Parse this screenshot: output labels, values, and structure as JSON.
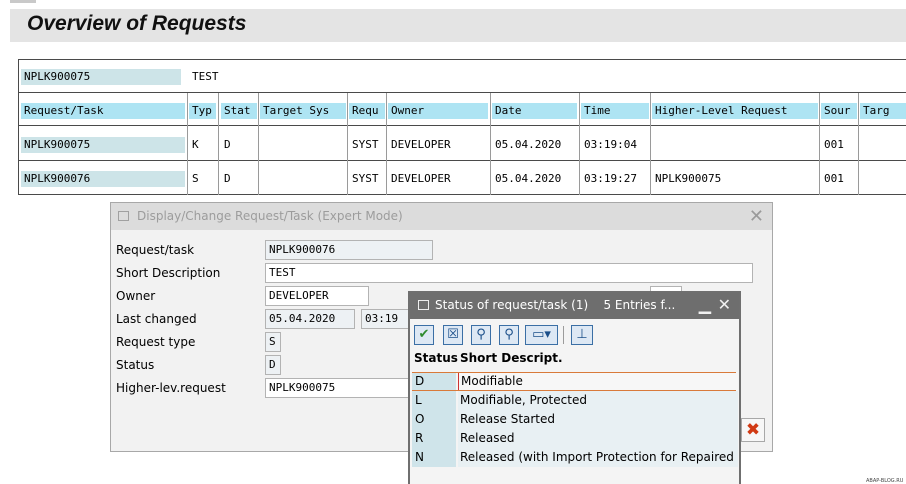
{
  "page": {
    "title": "Overview of Requests"
  },
  "header_row": {
    "request": "NPLK900075",
    "description": "TEST"
  },
  "table": {
    "columns": [
      "Request/Task",
      "Typ",
      "Stat",
      "Target Sys",
      "Requ",
      "Owner",
      "Date",
      "Time",
      "Higher-Level Request",
      "Sour",
      "Targ"
    ],
    "rows": [
      [
        "NPLK900075",
        "K",
        "D",
        "",
        "SYST",
        "DEVELOPER",
        "05.04.2020",
        "03:19:04",
        "",
        "001",
        ""
      ],
      [
        "NPLK900076",
        "S",
        "D",
        "",
        "SYST",
        "DEVELOPER",
        "05.04.2020",
        "03:19:27",
        "NPLK900075",
        "001",
        ""
      ]
    ]
  },
  "dialog": {
    "title": "Display/Change Request/Task (Expert Mode)",
    "labels": {
      "request_task": "Request/task",
      "short_description": "Short Description",
      "owner": "Owner",
      "last_changed": "Last changed",
      "request_type": "Request type",
      "status": "Status",
      "higher_level_request": "Higher-lev.request"
    },
    "values": {
      "request_task": "NPLK900076",
      "short_description": "TEST",
      "owner": "DEVELOPER",
      "last_changed_date": "05.04.2020",
      "last_changed_time": "03:19",
      "request_type": "S",
      "status": "D",
      "higher_level_request": "NPLK900075"
    }
  },
  "status_popup": {
    "title": "Status of request/task (1)",
    "entries_info": "5 Entries f...",
    "col_status": "Status",
    "col_desc": "Short Descript.",
    "items": [
      {
        "code": "D",
        "text": "Modifiable"
      },
      {
        "code": "L",
        "text": "Modifiable, Protected"
      },
      {
        "code": "O",
        "text": "Release Started"
      },
      {
        "code": "R",
        "text": "Released"
      },
      {
        "code": "N",
        "text": "Released (with Import Protection for Repaired O"
      }
    ],
    "toolbar_icons": [
      "check-icon",
      "cancel-icon",
      "find-icon",
      "find-next-icon",
      "print-icon",
      "filter-icon"
    ]
  },
  "colors": {
    "header_bg": "#aee4f3",
    "key_bg": "#cde4e8",
    "popup_caption": "#6e6e6e",
    "cancel_red": "#d13a14"
  },
  "watermark": "ABAP-BLOG.RU"
}
